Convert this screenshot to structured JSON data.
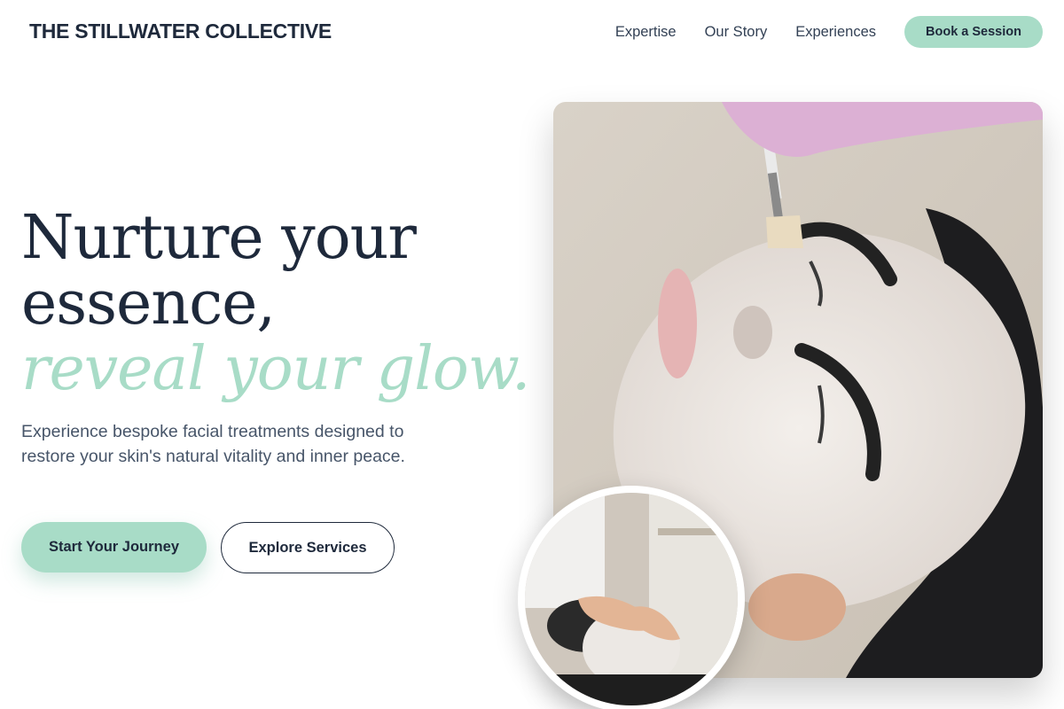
{
  "header": {
    "brand": "THE STILLWATER COLLECTIVE",
    "nav": [
      {
        "label": "Expertise"
      },
      {
        "label": "Our Story"
      },
      {
        "label": "Experiences"
      }
    ],
    "book_label": "Book a Session"
  },
  "hero": {
    "title_line1": "Nurture your",
    "title_line2": "essence,",
    "title_accent": "reveal your glow.",
    "subtitle": "Experience bespoke facial treatments designed to restore your skin's natural vitality and inner peace.",
    "primary_cta": "Start Your Journey",
    "secondary_cta": "Explore Services"
  },
  "colors": {
    "accent": "#a8dcc7",
    "text_dark": "#1e293b",
    "text_muted": "#475569"
  }
}
